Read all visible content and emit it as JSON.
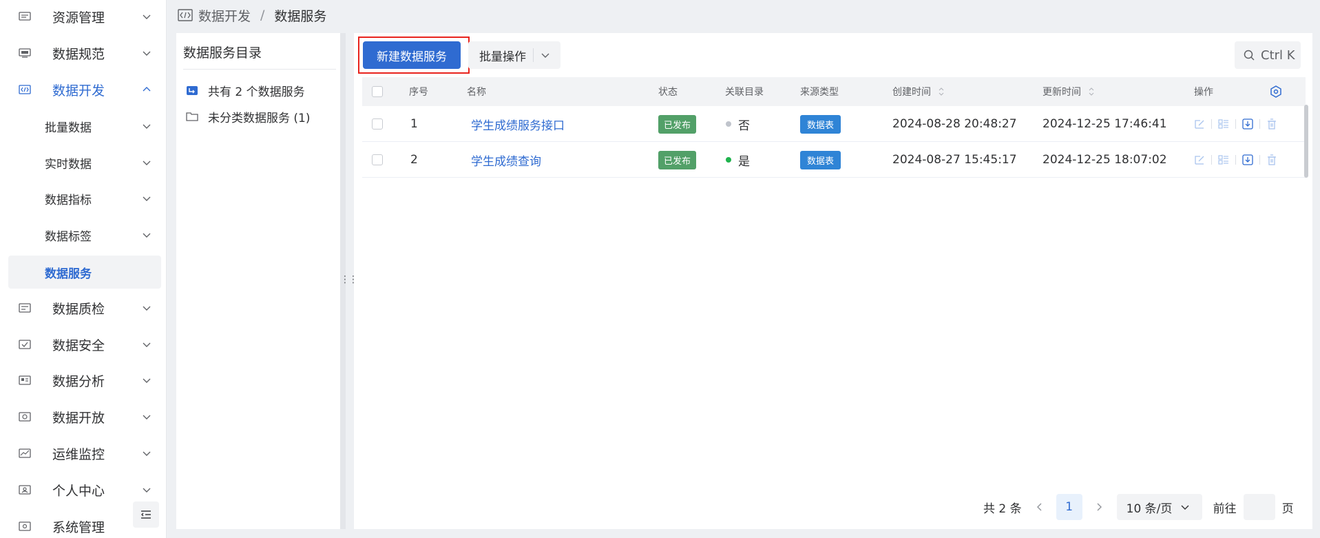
{
  "sidebar": {
    "items": [
      {
        "label": "资源管理",
        "icon": "resource-icon"
      },
      {
        "label": "数据规范",
        "icon": "standard-icon"
      },
      {
        "label": "数据开发",
        "icon": "code-icon",
        "open": true
      },
      {
        "label": "数据质检",
        "icon": "quality-icon"
      },
      {
        "label": "数据安全",
        "icon": "security-icon"
      },
      {
        "label": "数据分析",
        "icon": "analysis-icon"
      },
      {
        "label": "数据开放",
        "icon": "open-icon"
      },
      {
        "label": "运维监控",
        "icon": "monitor-icon"
      },
      {
        "label": "个人中心",
        "icon": "user-icon"
      },
      {
        "label": "系统管理",
        "icon": "system-icon"
      }
    ],
    "subitems": [
      {
        "label": "批量数据"
      },
      {
        "label": "实时数据"
      },
      {
        "label": "数据指标"
      },
      {
        "label": "数据标签"
      },
      {
        "label": "数据服务",
        "active": true
      }
    ]
  },
  "breadcrumb": {
    "first": "数据开发",
    "separator": "/",
    "last": "数据服务"
  },
  "catalog": {
    "title": "数据服务目录",
    "nodes": [
      {
        "label": "共有 2 个数据服务"
      },
      {
        "label": "未分类数据服务 (1)"
      }
    ]
  },
  "toolbar": {
    "new_label": "新建数据服务",
    "batch_label": "批量操作",
    "search_label": "Ctrl K"
  },
  "table": {
    "headers": {
      "index": "序号",
      "name": "名称",
      "status": "状态",
      "linked": "关联目录",
      "source": "来源类型",
      "created": "创建时间",
      "updated": "更新时间",
      "ops": "操作"
    },
    "rows": [
      {
        "index": "1",
        "name": "学生成绩服务接口",
        "status": "已发布",
        "linked": "否",
        "linked_color": "#c0c4cc",
        "source": "数据表",
        "created": "2024-08-28 20:48:27",
        "updated": "2024-12-25 17:46:41"
      },
      {
        "index": "2",
        "name": "学生成绩查询",
        "status": "已发布",
        "linked": "是",
        "linked_color": "#1fb34d",
        "source": "数据表",
        "created": "2024-08-27 15:45:17",
        "updated": "2024-12-25 18:07:02"
      }
    ]
  },
  "pagination": {
    "total": "共 2 条",
    "current_page": "1",
    "page_size": "10 条/页",
    "goto_prefix": "前往",
    "goto_suffix": "页"
  },
  "colors": {
    "primary": "#2f6bd1",
    "published": "#52a068",
    "source_tag": "#2f84d6",
    "highlight": "#e8231d"
  }
}
